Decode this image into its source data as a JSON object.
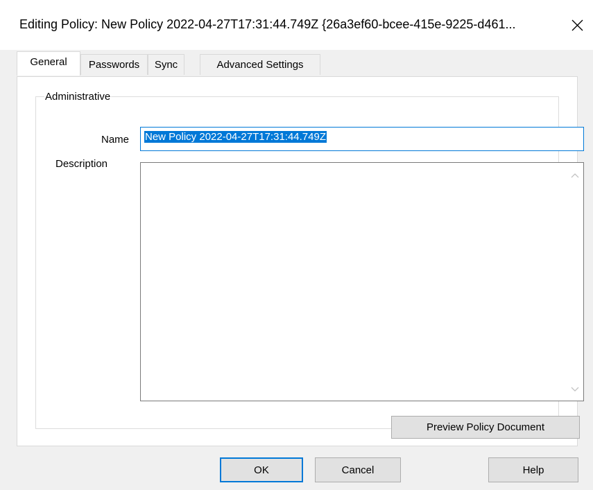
{
  "window": {
    "title": "Editing Policy:  New Policy 2022-04-27T17:31:44.749Z {26a3ef60-bcee-415e-9225-d461...",
    "close_glyph": "close-icon"
  },
  "tabs": [
    {
      "label": "General",
      "active": true
    },
    {
      "label": "Passwords",
      "active": false
    },
    {
      "label": "Sync",
      "active": false
    },
    {
      "label": "Advanced Settings",
      "active": false
    }
  ],
  "general": {
    "group_label": "Administrative",
    "name_label": "Name",
    "name_value": "New Policy 2022-04-27T17:31:44.749Z",
    "description_label": "Description",
    "description_value": "",
    "preview_button": "Preview Policy Document"
  },
  "footer": {
    "ok": "OK",
    "cancel": "Cancel",
    "help": "Help"
  },
  "colors": {
    "accent": "#0078d7",
    "window_bg": "#f0f0f0"
  }
}
